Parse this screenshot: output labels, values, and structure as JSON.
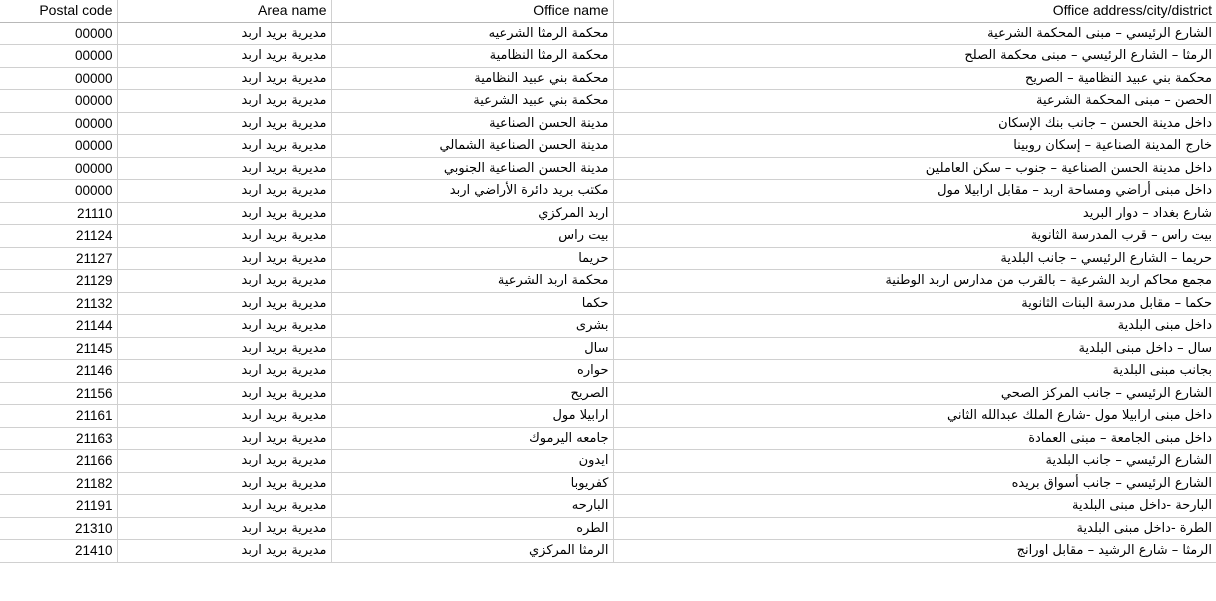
{
  "table": {
    "columns": [
      {
        "key": "postal_code",
        "label": "Postal code"
      },
      {
        "key": "area_name",
        "label": "Area name"
      },
      {
        "key": "office_name",
        "label": "Office name"
      },
      {
        "key": "office_address",
        "label": "Office address/city/district"
      }
    ],
    "rows": [
      {
        "postal_code": "00000",
        "area_name": "مديرية بريد اربد",
        "office_name": "محكمة الرمثا الشرعيه",
        "office_address": "الشارع الرئيسي – مبنى المحكمة الشرعية"
      },
      {
        "postal_code": "00000",
        "area_name": "مديرية بريد اربد",
        "office_name": "محكمة الرمثا النظامية",
        "office_address": "الرمثا – الشارع الرئيسي – مبنى محكمة  الصلح"
      },
      {
        "postal_code": "00000",
        "area_name": "مديرية بريد اربد",
        "office_name": "محكمة بني عبيد النظامية",
        "office_address": "محكمة بني عبيد النظامية –  الصريح"
      },
      {
        "postal_code": "00000",
        "area_name": "مديرية بريد اربد",
        "office_name": "محكمة بني عبيد الشرعية",
        "office_address": "الحصن – مبنى المحكمة الشرعية"
      },
      {
        "postal_code": "00000",
        "area_name": "مديرية بريد اربد",
        "office_name": "مدينة الحسن الصناعية",
        "office_address": "داخل مدينة الحسن – جانب بنك الإسكان"
      },
      {
        "postal_code": "00000",
        "area_name": "مديرية بريد اربد",
        "office_name": "مدينة الحسن الصناعية الشمالي",
        "office_address": "خارج المدينة الصناعية – إسكان روبينا"
      },
      {
        "postal_code": "00000",
        "area_name": "مديرية بريد اربد",
        "office_name": "مدينة الحسن الصناعية الجنوبي",
        "office_address": "داخل مدينة الحسن الصناعية – جنوب – سكن العاملين"
      },
      {
        "postal_code": "00000",
        "area_name": "مديرية بريد اربد",
        "office_name": "مكتب بريد دائرة الأراضي اربد",
        "office_address": "داخل مبنى أراضي ومساحة اربد – مقابل ارابيلا مول"
      },
      {
        "postal_code": "21110",
        "area_name": "مديرية بريد اربد",
        "office_name": "اربد المركزي",
        "office_address": "شارع بغداد – دوار البريد"
      },
      {
        "postal_code": "21124",
        "area_name": "مديرية بريد اربد",
        "office_name": "بيت راس",
        "office_address": "بيت راس – قرب المدرسة الثانوية"
      },
      {
        "postal_code": "21127",
        "area_name": "مديرية بريد اربد",
        "office_name": "حريما",
        "office_address": "حريما – الشارع الرئيسي – جانب البلدية"
      },
      {
        "postal_code": "21129",
        "area_name": "مديرية بريد اربد",
        "office_name": "محكمة اربد الشرعية",
        "office_address": "مجمع محاكم اربد الشرعية – بالقرب من مدارس اربد الوطنية"
      },
      {
        "postal_code": "21132",
        "area_name": "مديرية بريد اربد",
        "office_name": "حكما",
        "office_address": "حكما – مقابل مدرسة البنات الثانوية"
      },
      {
        "postal_code": "21144",
        "area_name": "مديرية بريد اربد",
        "office_name": "بشرى",
        "office_address": "داخل مبنى البلدية"
      },
      {
        "postal_code": "21145",
        "area_name": "مديرية بريد اربد",
        "office_name": "سال",
        "office_address": "سال – داخل مبنى البلدية"
      },
      {
        "postal_code": "21146",
        "area_name": "مديرية بريد اربد",
        "office_name": "حواره",
        "office_address": "بجانب مبنى البلدية"
      },
      {
        "postal_code": "21156",
        "area_name": "مديرية بريد اربد",
        "office_name": "الصريح",
        "office_address": "الشارع الرئيسي – جانب المركز الصحي"
      },
      {
        "postal_code": "21161",
        "area_name": "مديرية بريد اربد",
        "office_name": "ارابيلا مول",
        "office_address": "داخل مبنى ارابيلا مول -شارع الملك عبدالله الثاني"
      },
      {
        "postal_code": "21163",
        "area_name": "مديرية بريد اربد",
        "office_name": "جامعه اليرموك",
        "office_address": "داخل مبنى الجامعة – مبنى العمادة"
      },
      {
        "postal_code": "21166",
        "area_name": "مديرية بريد اربد",
        "office_name": "ايدون",
        "office_address": "الشارع الرئيسي – جانب البلدية"
      },
      {
        "postal_code": "21182",
        "area_name": "مديرية بريد اربد",
        "office_name": "كفريوبا",
        "office_address": "الشارع الرئيسي – جانب أسواق بريده"
      },
      {
        "postal_code": "21191",
        "area_name": "مديرية بريد اربد",
        "office_name": "البارحه",
        "office_address": "البارحة -داخل مبنى البلدية"
      },
      {
        "postal_code": "21310",
        "area_name": "مديرية بريد اربد",
        "office_name": "الطره",
        "office_address": "الطرة -داخل مبنى البلدية"
      },
      {
        "postal_code": "21410",
        "area_name": "مديرية بريد اربد",
        "office_name": "الرمثا المركزي",
        "office_address": "الرمثا – شارع الرشيد – مقابل اورانج"
      }
    ]
  }
}
